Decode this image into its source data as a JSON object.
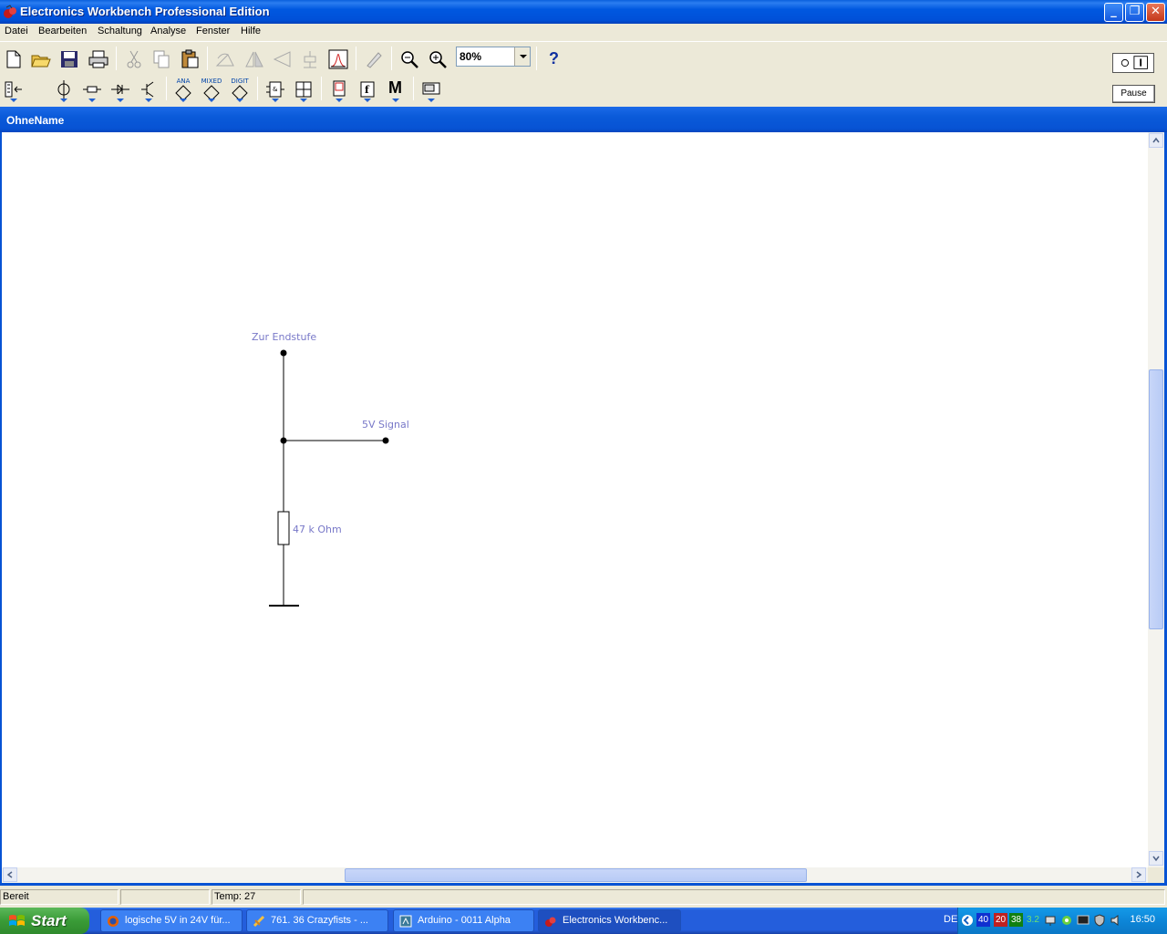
{
  "window": {
    "title": "Electronics Workbench Professional Edition"
  },
  "menu": [
    "Datei",
    "Bearbeiten",
    "Schaltung",
    "Analyse",
    "Fenster",
    "Hilfe"
  ],
  "toolbar": {
    "zoom_value": "80%",
    "help_label": "?",
    "pause_label": "Pause",
    "parts_labels": {
      "analog": "ANA",
      "mixed": "MIXED",
      "digital": "DIGIT",
      "misc": "M"
    }
  },
  "document": {
    "title": "OhneName"
  },
  "circuit": {
    "labels": {
      "top_node": "Zur Endstufe",
      "signal_node": "5V Signal",
      "resistor": "47 k Ohm"
    }
  },
  "status": {
    "state": "Bereit",
    "temp": "Temp:  27"
  },
  "taskbar": {
    "start_label": "Start",
    "tasks": [
      "logische 5V in 24V für...",
      "761. 36 Crazyfists - ...",
      "Arduino - 0011 Alpha",
      "Electronics Workbenc..."
    ],
    "language": "DE",
    "tray_numbers": [
      "40",
      "20",
      "38",
      "3.2"
    ],
    "clock": "16:50"
  },
  "colors": {
    "label": "#7878c8",
    "titlebar": "#0058e0",
    "taskbar": "#245edc"
  }
}
